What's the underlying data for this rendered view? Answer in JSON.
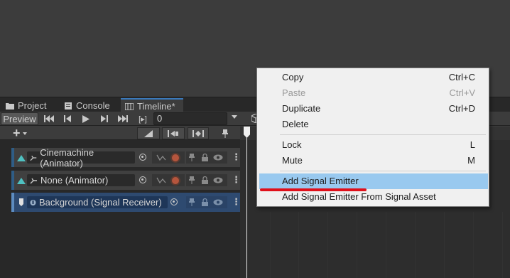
{
  "tabs": [
    {
      "label": "Project",
      "icon": "folder-icon"
    },
    {
      "label": "Console",
      "icon": "console-icon"
    },
    {
      "label": "Timeline*",
      "icon": "timeline-icon"
    }
  ],
  "toolbar": {
    "preview_label": "Preview",
    "frame_value": "0",
    "bracket_label": "[▸]"
  },
  "tracks": [
    {
      "label": "Cinemachine (Animator)",
      "type": "animation"
    },
    {
      "label": "None (Animator)",
      "type": "animation"
    },
    {
      "label": "Background (Signal Receiver)",
      "type": "signal"
    }
  ],
  "context_menu": {
    "items": [
      {
        "label": "Copy",
        "shortcut": "Ctrl+C",
        "disabled": false
      },
      {
        "label": "Paste",
        "shortcut": "Ctrl+V",
        "disabled": true
      },
      {
        "label": "Duplicate",
        "shortcut": "Ctrl+D",
        "disabled": false
      },
      {
        "label": "Delete",
        "shortcut": "",
        "disabled": false
      },
      {
        "label": "Lock",
        "shortcut": "L",
        "disabled": false
      },
      {
        "label": "Mute",
        "shortcut": "M",
        "disabled": false
      },
      {
        "label": "Add Signal Emitter",
        "shortcut": "",
        "disabled": false,
        "highlighted": true
      },
      {
        "label": "Add Signal Emitter From Signal Asset",
        "shortcut": "",
        "disabled": false
      }
    ]
  },
  "colors": {
    "accent": "#3a79bb",
    "menu_highlight": "#99c9ef",
    "annotation_red": "#e0101a",
    "record": "#b5553d"
  }
}
